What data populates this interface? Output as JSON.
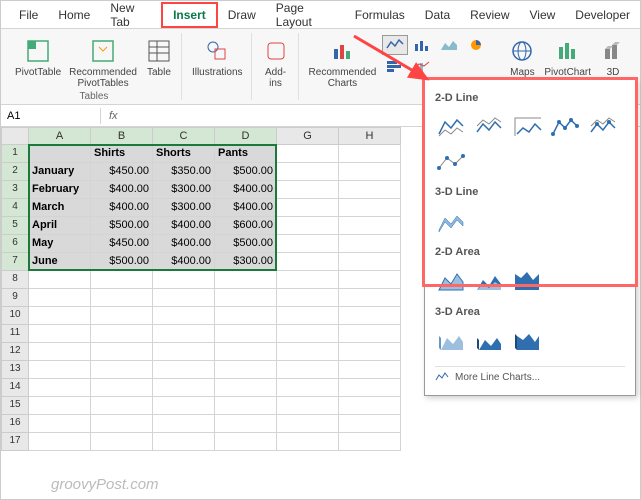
{
  "menubar": {
    "tabs": [
      "File",
      "Home",
      "New Tab",
      "Insert",
      "Draw",
      "Page Layout",
      "Formulas",
      "Data",
      "Review",
      "View",
      "Developer"
    ],
    "active": "Insert"
  },
  "ribbon": {
    "tables": {
      "label": "Tables",
      "items": [
        "PivotTable",
        "Recommended\nPivotTables",
        "Table"
      ]
    },
    "illustrations": {
      "label": "Illustrations"
    },
    "addins": {
      "label": "Add-\nins"
    },
    "charts_group": {
      "recommended": "Recommended\nCharts",
      "maps": "Maps",
      "pivotchart": "PivotChart",
      "three_d": "3D"
    }
  },
  "namebox": {
    "value": "A1"
  },
  "columns": [
    "A",
    "B",
    "C",
    "D",
    "G",
    "H"
  ],
  "table": {
    "headers": [
      "",
      "Shirts",
      "Shorts",
      "Pants"
    ],
    "rows": [
      {
        "label": "January",
        "values": [
          "$450.00",
          "$350.00",
          "$500.00"
        ]
      },
      {
        "label": "February",
        "values": [
          "$400.00",
          "$300.00",
          "$400.00"
        ]
      },
      {
        "label": "March",
        "values": [
          "$400.00",
          "$300.00",
          "$400.00"
        ]
      },
      {
        "label": "April",
        "values": [
          "$500.00",
          "$400.00",
          "$600.00"
        ]
      },
      {
        "label": "May",
        "values": [
          "$450.00",
          "$400.00",
          "$500.00"
        ]
      },
      {
        "label": "June",
        "values": [
          "$500.00",
          "$400.00",
          "$300.00"
        ]
      }
    ]
  },
  "dropdown": {
    "sections": {
      "line2d": "2-D Line",
      "line3d": "3-D Line",
      "area2d": "2-D Area",
      "area3d": "3-D Area"
    },
    "more": "More Line Charts..."
  },
  "chart_data": {
    "type": "table",
    "categories": [
      "January",
      "February",
      "March",
      "April",
      "May",
      "June"
    ],
    "series": [
      {
        "name": "Shirts",
        "values": [
          450.0,
          400.0,
          400.0,
          500.0,
          450.0,
          500.0
        ]
      },
      {
        "name": "Shorts",
        "values": [
          350.0,
          300.0,
          300.0,
          400.0,
          400.0,
          400.0
        ]
      },
      {
        "name": "Pants",
        "values": [
          500.0,
          400.0,
          400.0,
          600.0,
          500.0,
          300.0
        ]
      }
    ],
    "title": "",
    "xlabel": "",
    "ylabel": ""
  },
  "watermark": "groovyPost.com"
}
